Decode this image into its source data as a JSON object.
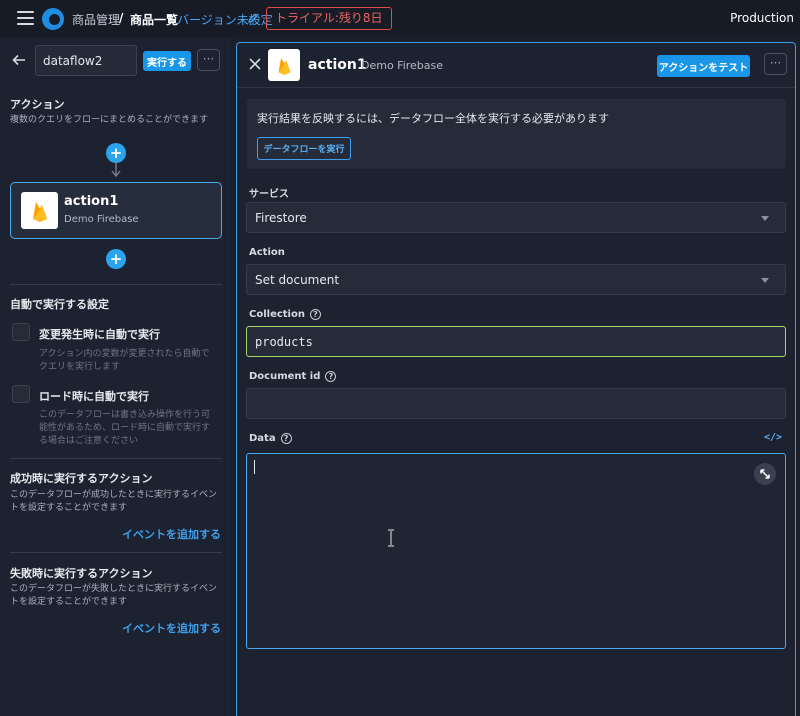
{
  "topbar": {
    "crumb_1": "商品管理",
    "separator": "/",
    "crumb_2": "商品一覧",
    "version_link": "バージョン未設定",
    "trial_badge": "トライアル:残り8日",
    "environment": "Production"
  },
  "left": {
    "flow_name": "dataflow2",
    "run_button": "実行する",
    "more": "···",
    "actions_title": "アクション",
    "actions_desc": "複数のクエリをフローにまとめることができます",
    "add": "+",
    "action_card": {
      "name": "action1",
      "source": "Demo Firebase"
    },
    "auto_title": "自動で実行する設定",
    "auto_on_change": {
      "label": "変更発生時に自動で実行",
      "desc": "アクション内の変数が変更されたら自動でクエリを実行します"
    },
    "auto_on_load": {
      "label": "ロード時に自動で実行",
      "desc": "このデータフローは書き込み操作を行う可能性があるため、ロード時に自動で実行する場合はご注意ください"
    },
    "success_title": "成功時に実行するアクション",
    "success_desc": "このデータフローが成功したときに実行するイベントを設定することができます",
    "success_link": "イベントを追加する",
    "failure_title": "失敗時に実行するアクション",
    "failure_desc": "このデータフローが失敗したときに実行するイベントを設定することができます",
    "failure_link": "イベントを追加する"
  },
  "right": {
    "title": "action1",
    "subtitle": "Demo Firebase",
    "test_button": "アクションをテスト",
    "more": "···",
    "notice": {
      "text": "実行結果を反映するには、データフロー全体を実行する必要があります",
      "button": "データフローを実行"
    },
    "service": {
      "label": "サービス",
      "value": "Firestore"
    },
    "action": {
      "label": "Action",
      "value": "Set document"
    },
    "collection": {
      "label": "Collection",
      "value": "products"
    },
    "document_id": {
      "label": "Document id",
      "value": ""
    },
    "data": {
      "label": "Data",
      "value": "",
      "code_toggle": "</>"
    },
    "help": "?"
  },
  "colors": {
    "accent": "#1a96e8",
    "link": "#3f9fec",
    "trial_red": "#e24b4b",
    "focus_green": "#a9d46a",
    "firebase_orange": "#f5a623",
    "firebase_yellow": "#ffcb2b"
  },
  "icons": [
    "menu-icon",
    "logo-icon",
    "pencil-icon",
    "back-arrow-icon",
    "firebase-icon",
    "close-icon",
    "help-icon",
    "chevron-down-icon",
    "code-icon",
    "expand-icon",
    "text-cursor-icon"
  ]
}
